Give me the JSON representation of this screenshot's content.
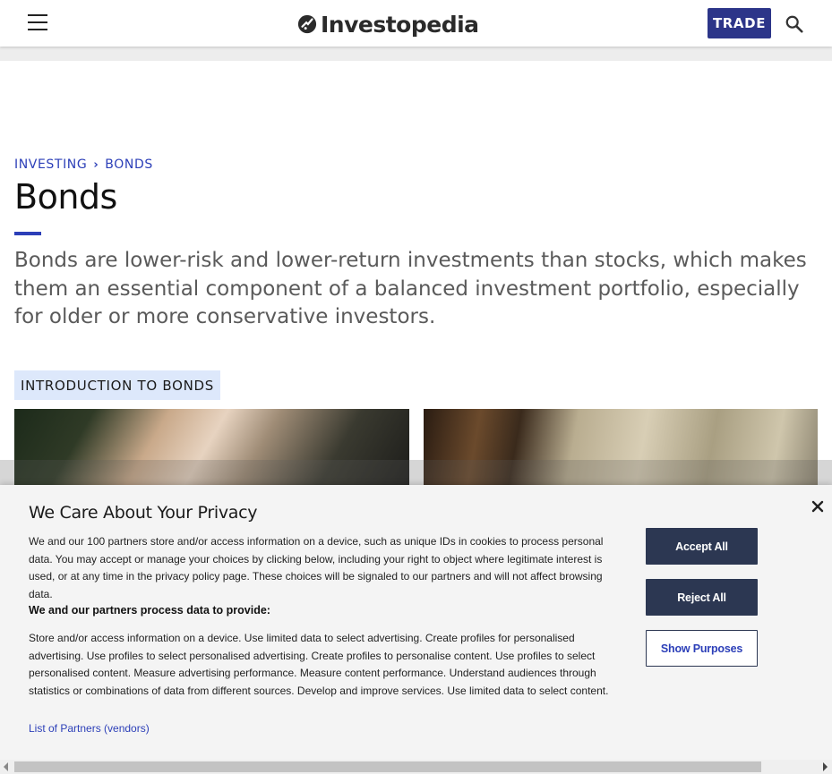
{
  "header": {
    "logo_text": "Investopedia",
    "trade_label": "TRADE",
    "colors": {
      "accent": "#2c3589",
      "link": "#2c3fb8"
    }
  },
  "breadcrumb": {
    "items": [
      "INVESTING",
      "BONDS"
    ]
  },
  "page": {
    "title": "Bonds",
    "intro": "Bonds are lower-risk and lower-return investments than stocks, which makes them an essential component of a balanced investment portfolio, especially for older or more conservative investors.",
    "section_tag": "INTRODUCTION TO BONDS"
  },
  "privacy": {
    "title": "We Care About Your Privacy",
    "text1": "We and our 100 partners store and/or access information on a device, such as unique IDs in cookies to process personal data. You may accept or manage your choices by clicking below, including your right to object where legitimate interest is used, or at any time in the privacy policy page. These choices will be signaled to our partners and will not affect browsing data.",
    "subheading": "We and our partners process data to provide:",
    "text2": "Store and/or access information on a device. Use limited data to select advertising. Create profiles for personalised advertising. Use profiles to select personalised advertising. Create profiles to personalise content. Use profiles to select personalised content. Measure advertising performance. Measure content performance. Understand audiences through statistics or combinations of data from different sources. Develop and improve services. Use limited data to select content.",
    "partners_link": "List of Partners (vendors)",
    "accept_label": "Accept All",
    "reject_label": "Reject All",
    "purposes_label": "Show Purposes",
    "colors": {
      "button": "#2c3752"
    }
  }
}
